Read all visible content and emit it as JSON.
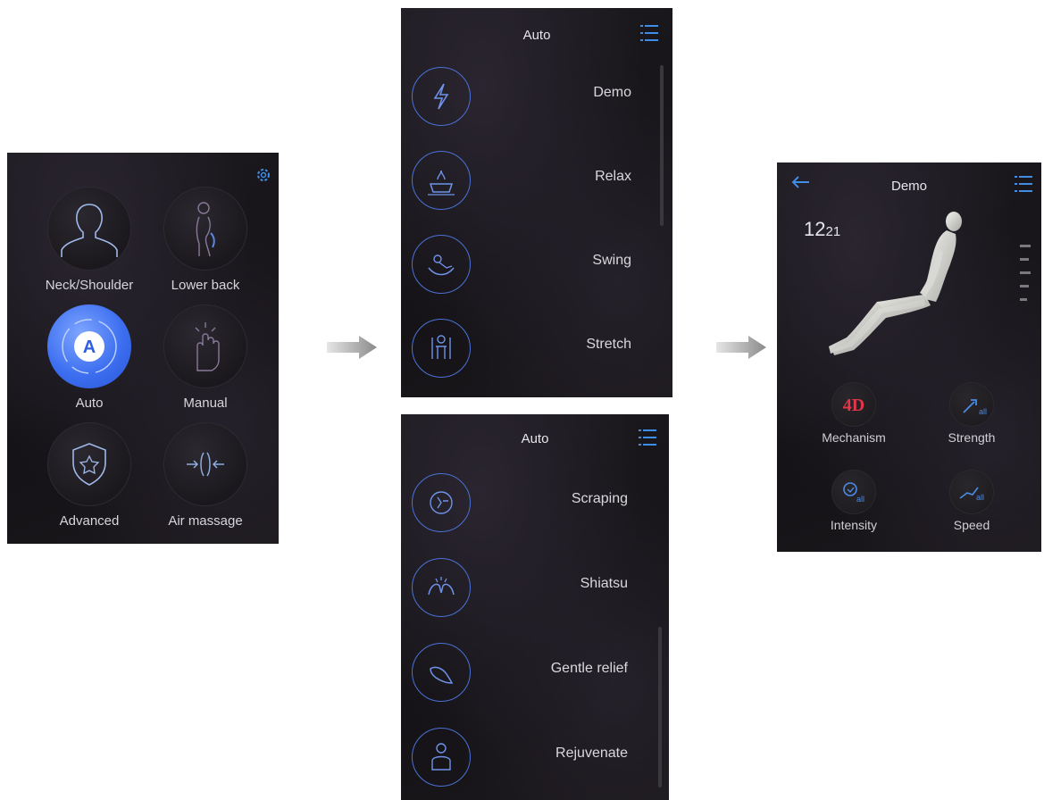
{
  "home": {
    "tiles": [
      {
        "label": "Neck/Shoulder",
        "icon": "neck-shoulder-icon"
      },
      {
        "label": "Lower back",
        "icon": "lower-back-icon"
      },
      {
        "label": "Auto",
        "icon": "auto-icon",
        "badge": "A"
      },
      {
        "label": "Manual",
        "icon": "manual-icon"
      },
      {
        "label": "Advanced",
        "icon": "advanced-icon"
      },
      {
        "label": "Air massage",
        "icon": "air-massage-icon"
      }
    ],
    "settings_icon": "gear-icon"
  },
  "auto_list_1": {
    "title": "Auto",
    "items": [
      {
        "label": "Demo",
        "icon": "lightning-icon"
      },
      {
        "label": "Relax",
        "icon": "relax-icon"
      },
      {
        "label": "Swing",
        "icon": "swing-icon"
      },
      {
        "label": "Stretch",
        "icon": "stretch-icon"
      }
    ]
  },
  "auto_list_2": {
    "title": "Auto",
    "items": [
      {
        "label": "Scraping",
        "icon": "scraping-icon"
      },
      {
        "label": "Shiatsu",
        "icon": "shiatsu-icon"
      },
      {
        "label": "Gentle relief",
        "icon": "gentle-relief-icon"
      },
      {
        "label": "Rejuvenate",
        "icon": "rejuvenate-icon"
      }
    ]
  },
  "demo": {
    "title": "Demo",
    "time_hours": "12",
    "time_minutes": "21",
    "functions": [
      {
        "label": "Mechanism",
        "badge": "4D"
      },
      {
        "label": "Strength",
        "badge": "all"
      },
      {
        "label": "Intensity",
        "badge": "all"
      },
      {
        "label": "Speed",
        "badge": "all"
      }
    ]
  },
  "colors": {
    "accent": "#3e8ee8",
    "ring": "#4a72d6",
    "auto_active": "#3d6ff0",
    "badge_4d": "#e0354a"
  }
}
